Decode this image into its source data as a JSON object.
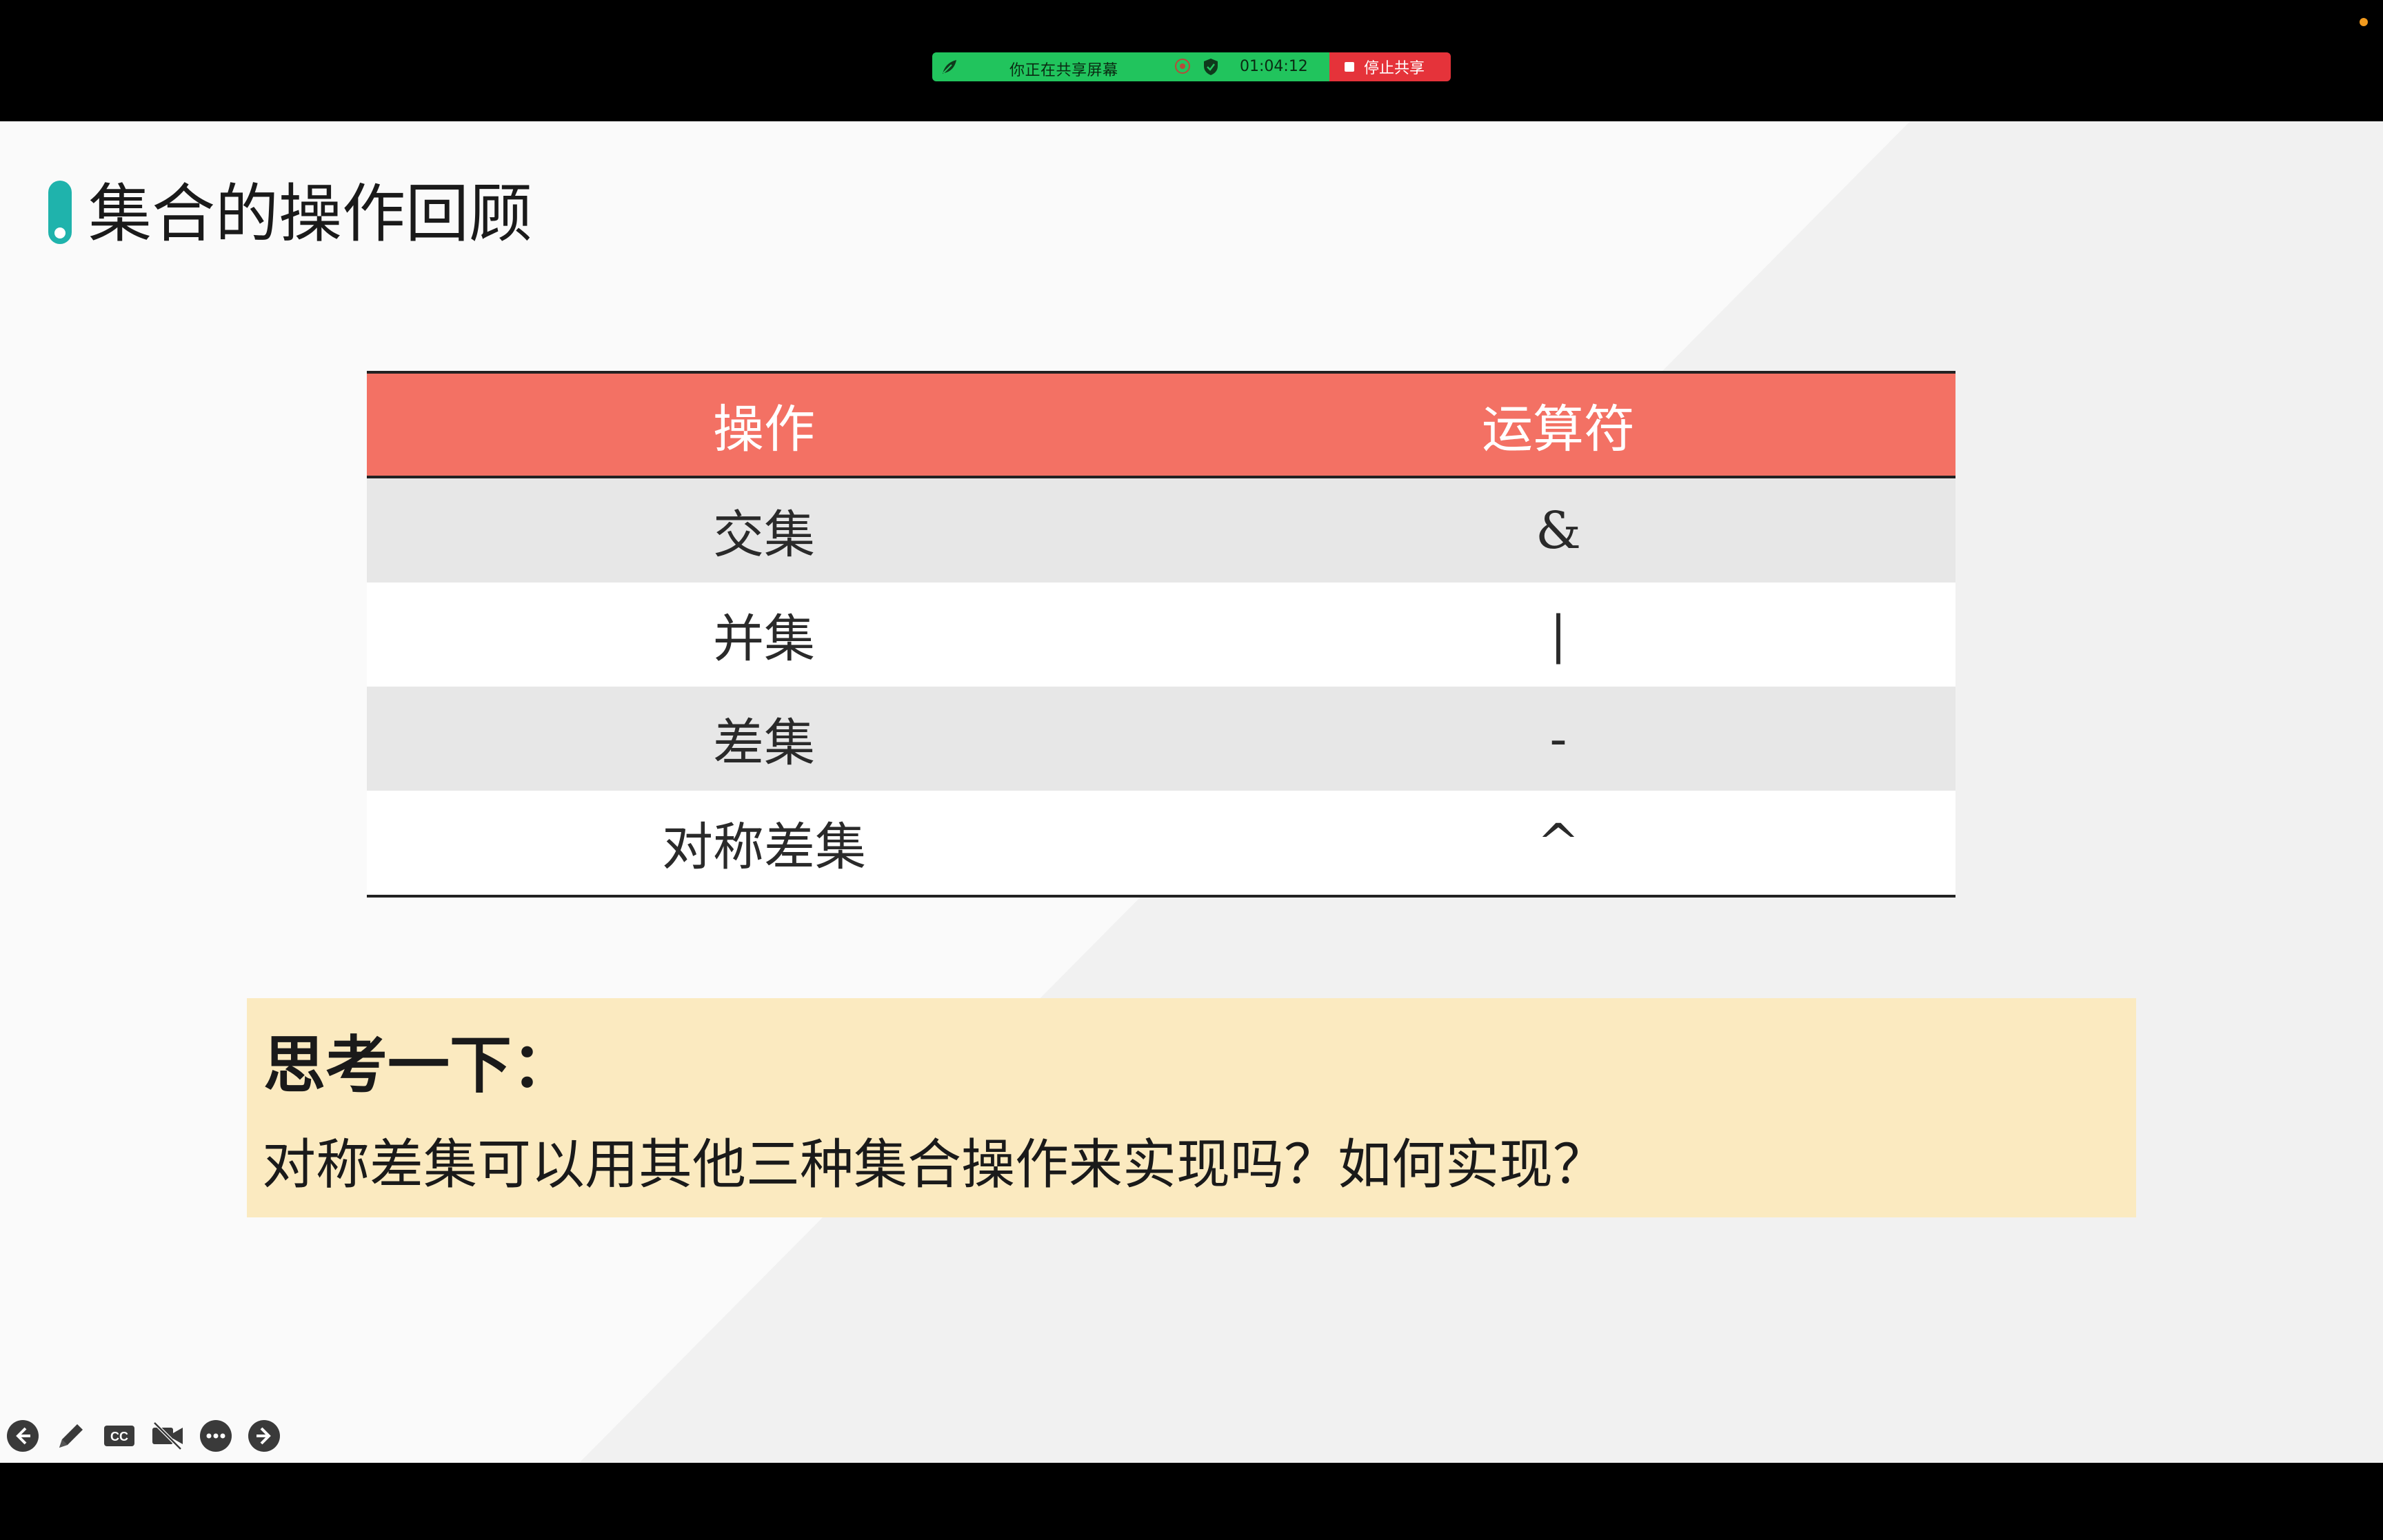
{
  "share_bar": {
    "status_text": "你正在共享屏幕",
    "timer": "01:04:12",
    "stop_label": "停止共享"
  },
  "slide": {
    "title": "集合的操作回顾",
    "table": {
      "headers": [
        "操作",
        "运算符"
      ],
      "rows": [
        {
          "operation": "交集",
          "operator": "&"
        },
        {
          "operation": "并集",
          "operator": "|"
        },
        {
          "operation": "差集",
          "operator": "-"
        },
        {
          "operation": "对称差集",
          "operator": "^"
        }
      ]
    },
    "think": {
      "title": "思考一下：",
      "body": "对称差集可以用其他三种集合操作来实现吗？如何实现？"
    }
  },
  "controls": [
    "back-icon",
    "pen-icon",
    "cc-icon",
    "video-off-icon",
    "more-icon",
    "forward-icon"
  ],
  "colors": {
    "header_row": "#f37164",
    "accent_marker": "#1fb3ac",
    "think_box": "#fbeac0",
    "share_green": "#21c45d",
    "share_red": "#e5333a"
  }
}
